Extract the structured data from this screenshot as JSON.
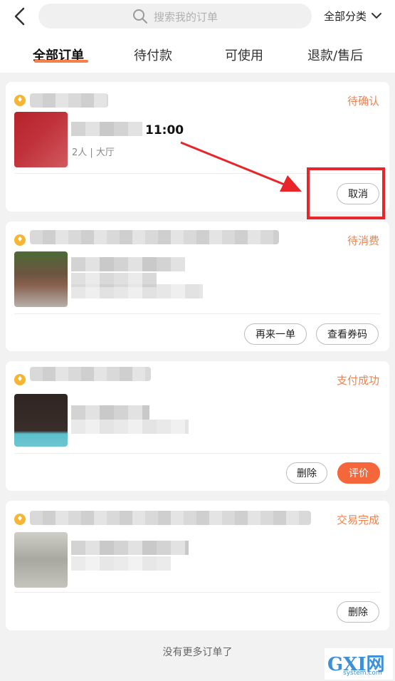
{
  "header": {
    "search_placeholder": "搜索我的订单",
    "category_label": "全部分类"
  },
  "tabs": [
    {
      "label": "全部订单",
      "active": true
    },
    {
      "label": "待付款",
      "active": false
    },
    {
      "label": "可使用",
      "active": false
    },
    {
      "label": "退款/售后",
      "active": false
    }
  ],
  "orders": [
    {
      "shop_name": "",
      "status": "待确认",
      "time": "11:00",
      "detail": "2人 | 大厅",
      "buttons": [
        "取消"
      ]
    },
    {
      "shop_name": "",
      "status": "待消费",
      "buttons": [
        "再来一单",
        "查看券码"
      ]
    },
    {
      "shop_name": "",
      "status": "支付成功",
      "buttons": [
        "删除",
        "评价"
      ]
    },
    {
      "shop_name": "",
      "status": "交易完成",
      "buttons": [
        "删除"
      ]
    }
  ],
  "footer_text": "没有更多订单了",
  "watermark": {
    "main": "GXI网",
    "sub": "system.com"
  },
  "colors": {
    "accent": "#f5804a",
    "primary_button": "#f5663b",
    "annotation": "#e8262a"
  }
}
